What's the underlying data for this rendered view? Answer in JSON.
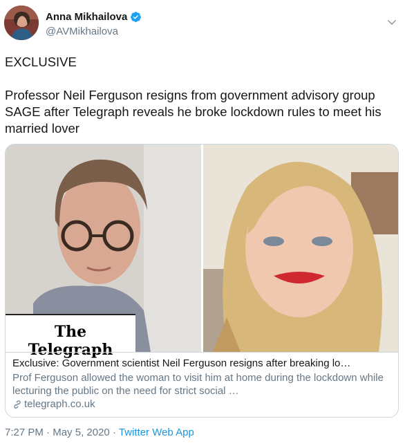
{
  "author": {
    "name": "Anna Mikhailova",
    "handle": "@AVMikhailova"
  },
  "tweet": {
    "line1": "EXCLUSIVE",
    "line2": "Professor Neil Ferguson resigns from government advisory group SAGE after Telegraph reveals he broke lockdown rules to meet his married lover"
  },
  "card": {
    "logo_text": "The Telegraph",
    "title": "Exclusive: Government scientist Neil Ferguson resigns after breaking lo…",
    "description": "Prof Ferguson allowed the woman to visit him at home during the lockdown while lecturing the public on the need for strict social …",
    "domain": "telegraph.co.uk"
  },
  "meta": {
    "time": "7:27 PM",
    "date": "May 5, 2020",
    "source": "Twitter Web App"
  },
  "colors": {
    "text": "#14171a",
    "secondary": "#657786",
    "accent": "#1b95e0",
    "border": "#ccd6dd",
    "verified": "#1da1f2"
  },
  "icons": [
    "verified-badge-icon",
    "caret-down-icon",
    "link-icon"
  ]
}
